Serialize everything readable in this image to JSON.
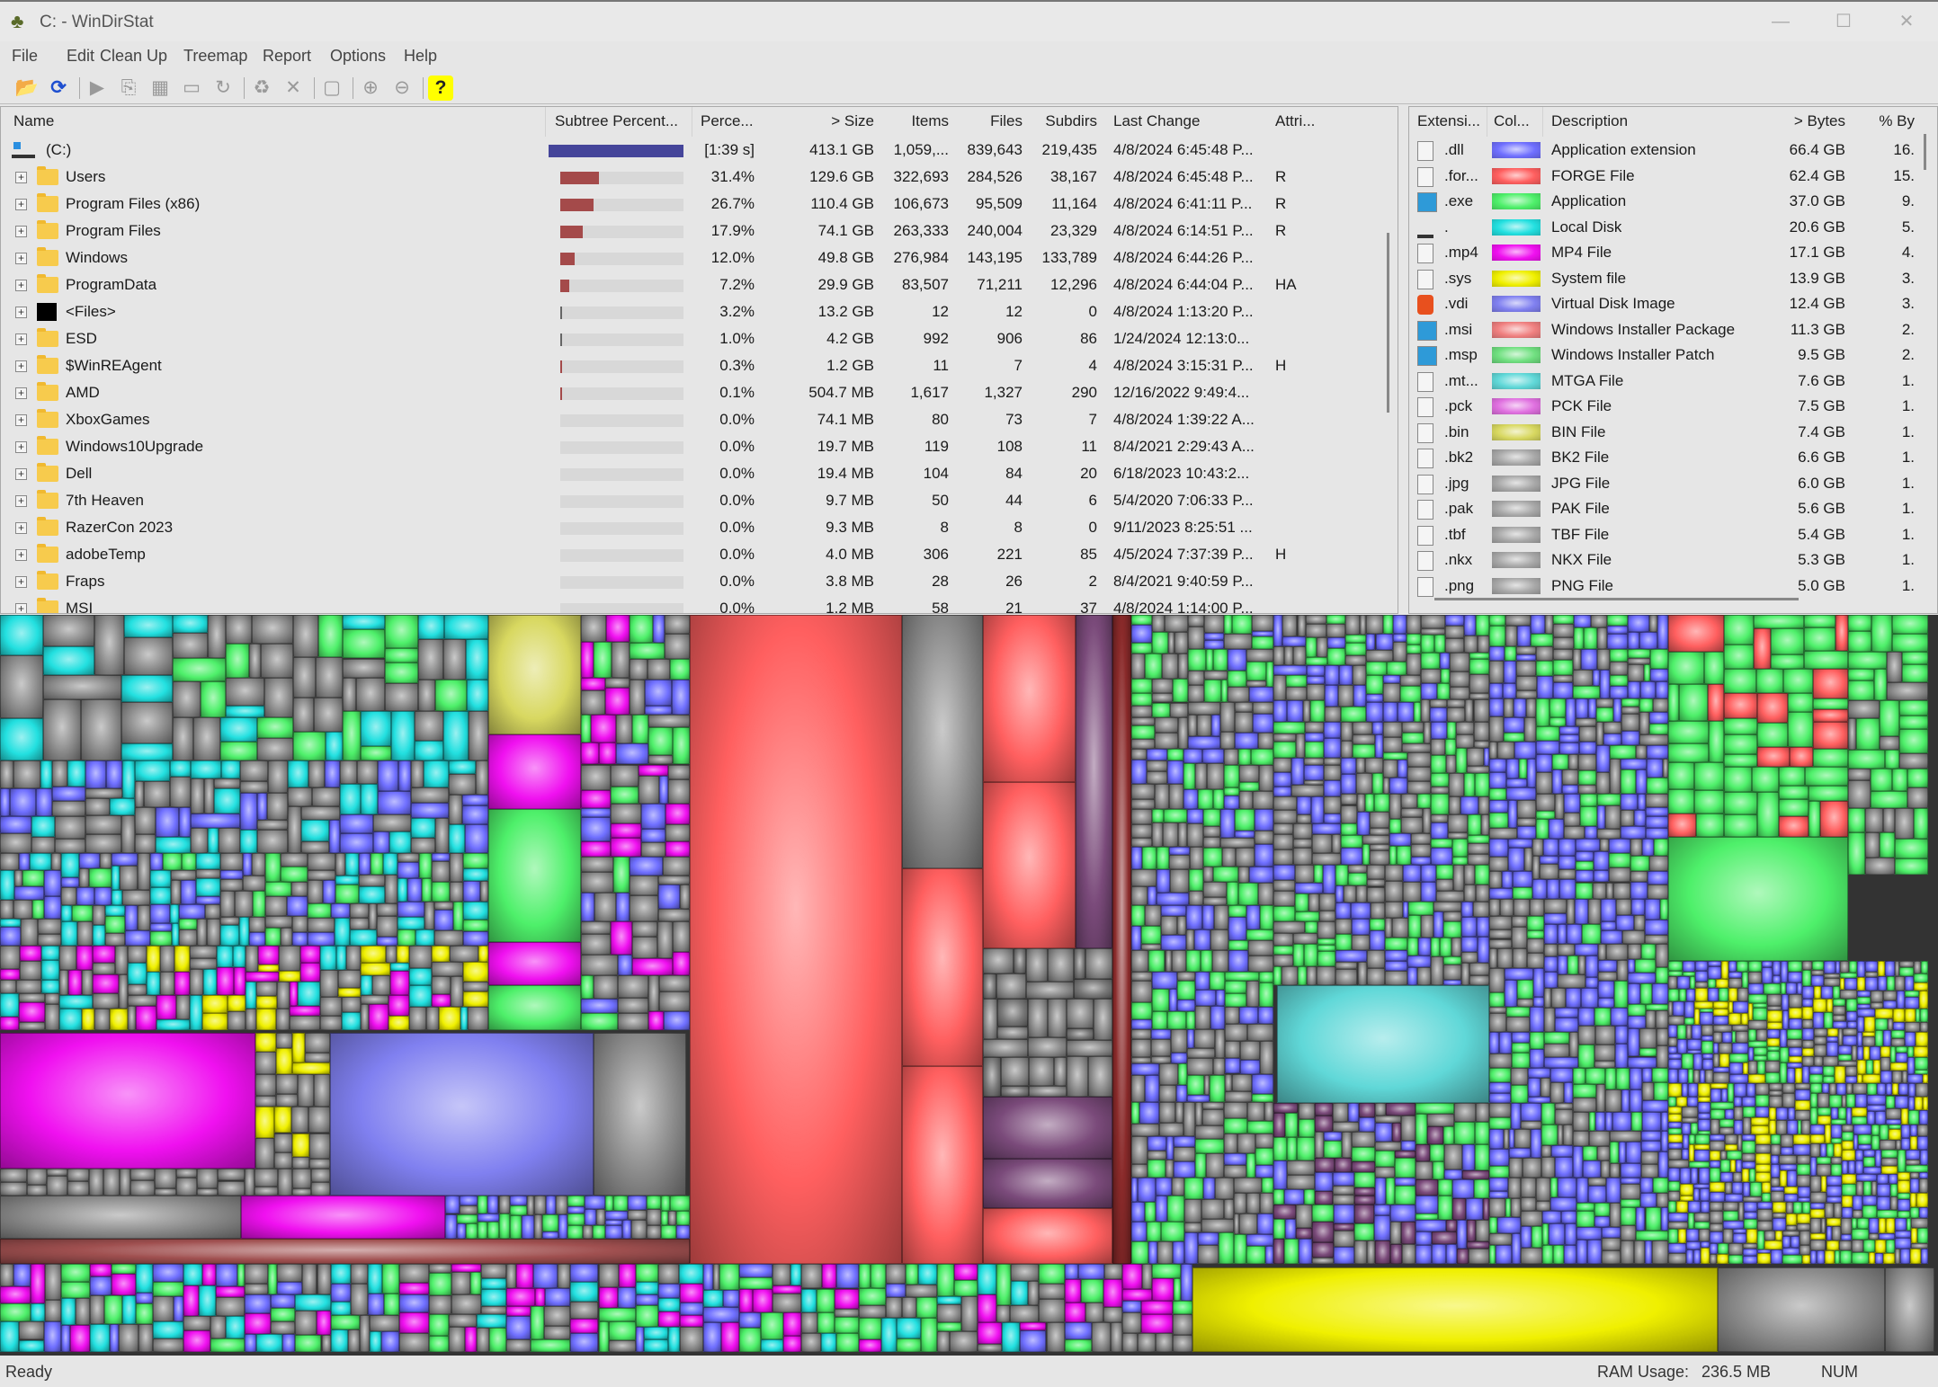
{
  "window": {
    "title": "C: - WinDirStat",
    "icon": "windirstat-tree-icon"
  },
  "menu": [
    "File",
    "Edit",
    "Clean Up",
    "Treemap",
    "Report",
    "Options",
    "Help"
  ],
  "toolbar": [
    "open-icon",
    "refresh-icon",
    "separator",
    "play-icon",
    "copy-path-icon",
    "explorer-icon",
    "command-prompt-icon",
    "refresh-selected-icon",
    "separator",
    "recycle-icon",
    "delete-icon",
    "separator",
    "new-folder-icon",
    "separator",
    "zoom-in-icon",
    "zoom-out-icon",
    "separator",
    "help-icon"
  ],
  "tree": {
    "columns": {
      "name": "Name",
      "subtree": "Subtree Percent...",
      "percent": "Perce...",
      "size": "> Size",
      "items": "Items",
      "files": "Files",
      "subdirs": "Subdirs",
      "last_change": "Last Change",
      "attributes": "Attri..."
    },
    "root": {
      "name": "(C:)",
      "percent": "[1:39 s]",
      "size": "413.1 GB",
      "items": "1,059,...",
      "files": "839,643",
      "subdirs": "219,435",
      "last_change": "4/8/2024 6:45:48 P...",
      "attributes": "",
      "subtree_fraction": 1.0
    },
    "rows": [
      {
        "name": "Users",
        "percent": "31.4%",
        "size": "129.6 GB",
        "items": "322,693",
        "files": "284,526",
        "subdirs": "38,167",
        "last_change": "4/8/2024 6:45:48 P...",
        "attributes": "R",
        "subtree_fraction": 0.314,
        "icon": "folder"
      },
      {
        "name": "Program Files (x86)",
        "percent": "26.7%",
        "size": "110.4 GB",
        "items": "106,673",
        "files": "95,509",
        "subdirs": "11,164",
        "last_change": "4/8/2024 6:41:11 P...",
        "attributes": "R",
        "subtree_fraction": 0.267,
        "icon": "folder"
      },
      {
        "name": "Program Files",
        "percent": "17.9%",
        "size": "74.1 GB",
        "items": "263,333",
        "files": "240,004",
        "subdirs": "23,329",
        "last_change": "4/8/2024 6:14:51 P...",
        "attributes": "R",
        "subtree_fraction": 0.179,
        "icon": "folder"
      },
      {
        "name": "Windows",
        "percent": "12.0%",
        "size": "49.8 GB",
        "items": "276,984",
        "files": "143,195",
        "subdirs": "133,789",
        "last_change": "4/8/2024 6:44:26 P...",
        "attributes": "",
        "subtree_fraction": 0.12,
        "icon": "folder"
      },
      {
        "name": "ProgramData",
        "percent": "7.2%",
        "size": "29.9 GB",
        "items": "83,507",
        "files": "71,211",
        "subdirs": "12,296",
        "last_change": "4/8/2024 6:44:04 P...",
        "attributes": "HA",
        "subtree_fraction": 0.072,
        "icon": "folder"
      },
      {
        "name": "<Files>",
        "percent": "3.2%",
        "size": "13.2 GB",
        "items": "12",
        "files": "12",
        "subdirs": "0",
        "last_change": "4/8/2024 1:13:20 P...",
        "attributes": "",
        "subtree_fraction": 0.032,
        "icon": "files"
      },
      {
        "name": "ESD",
        "percent": "1.0%",
        "size": "4.2 GB",
        "items": "992",
        "files": "906",
        "subdirs": "86",
        "last_change": "1/24/2024 12:13:0...",
        "attributes": "",
        "subtree_fraction": 0.01,
        "icon": "folder"
      },
      {
        "name": "$WinREAgent",
        "percent": "0.3%",
        "size": "1.2 GB",
        "items": "11",
        "files": "7",
        "subdirs": "4",
        "last_change": "4/8/2024 3:15:31 P...",
        "attributes": "H",
        "subtree_fraction": 0.003,
        "icon": "folder"
      },
      {
        "name": "AMD",
        "percent": "0.1%",
        "size": "504.7 MB",
        "items": "1,617",
        "files": "1,327",
        "subdirs": "290",
        "last_change": "12/16/2022 9:49:4...",
        "attributes": "",
        "subtree_fraction": 0.001,
        "icon": "folder"
      },
      {
        "name": "XboxGames",
        "percent": "0.0%",
        "size": "74.1 MB",
        "items": "80",
        "files": "73",
        "subdirs": "7",
        "last_change": "4/8/2024 1:39:22 A...",
        "attributes": "",
        "subtree_fraction": 0,
        "icon": "folder"
      },
      {
        "name": "Windows10Upgrade",
        "percent": "0.0%",
        "size": "19.7 MB",
        "items": "119",
        "files": "108",
        "subdirs": "11",
        "last_change": "8/4/2021 2:29:43 A...",
        "attributes": "",
        "subtree_fraction": 0,
        "icon": "folder"
      },
      {
        "name": "Dell",
        "percent": "0.0%",
        "size": "19.4 MB",
        "items": "104",
        "files": "84",
        "subdirs": "20",
        "last_change": "6/18/2023 10:43:2...",
        "attributes": "",
        "subtree_fraction": 0,
        "icon": "folder"
      },
      {
        "name": "7th Heaven",
        "percent": "0.0%",
        "size": "9.7 MB",
        "items": "50",
        "files": "44",
        "subdirs": "6",
        "last_change": "5/4/2020 7:06:33 P...",
        "attributes": "",
        "subtree_fraction": 0,
        "icon": "folder"
      },
      {
        "name": "RazerCon 2023",
        "percent": "0.0%",
        "size": "9.3 MB",
        "items": "8",
        "files": "8",
        "subdirs": "0",
        "last_change": "9/11/2023 8:25:51 ...",
        "attributes": "",
        "subtree_fraction": 0,
        "icon": "folder"
      },
      {
        "name": "adobeTemp",
        "percent": "0.0%",
        "size": "4.0 MB",
        "items": "306",
        "files": "221",
        "subdirs": "85",
        "last_change": "4/5/2024 7:37:39 P...",
        "attributes": "H",
        "subtree_fraction": 0,
        "icon": "folder"
      },
      {
        "name": "Fraps",
        "percent": "0.0%",
        "size": "3.8 MB",
        "items": "28",
        "files": "26",
        "subdirs": "2",
        "last_change": "8/4/2021 9:40:59 P...",
        "attributes": "",
        "subtree_fraction": 0,
        "icon": "folder"
      },
      {
        "name": "MSI",
        "percent": "0.0%",
        "size": "1.2 MB",
        "items": "58",
        "files": "21",
        "subdirs": "37",
        "last_change": "4/8/2024 1:14:00 P...",
        "attributes": "",
        "subtree_fraction": 0,
        "icon": "folder"
      }
    ]
  },
  "extensions": {
    "columns": {
      "ext": "Extensi...",
      "color": "Col...",
      "desc": "Description",
      "bytes": "> Bytes",
      "pct": "% By"
    },
    "rows": [
      {
        "ext": ".dll",
        "color": "#6f6fff",
        "desc": "Application extension",
        "bytes": "66.4 GB",
        "pct": "16."
      },
      {
        "ext": ".for...",
        "color": "#ff5f5f",
        "desc": "FORGE File",
        "bytes": "62.4 GB",
        "pct": "15."
      },
      {
        "ext": ".exe",
        "color": "#4ef06a",
        "desc": "Application",
        "bytes": "37.0 GB",
        "pct": "9."
      },
      {
        "ext": ".",
        "color": "#22e0e0",
        "desc": "Local Disk",
        "bytes": "20.6 GB",
        "pct": "5."
      },
      {
        "ext": ".mp4",
        "color": "#f010f0",
        "desc": "MP4 File",
        "bytes": "17.1 GB",
        "pct": "4."
      },
      {
        "ext": ".sys",
        "color": "#f0f000",
        "desc": "System file",
        "bytes": "13.9 GB",
        "pct": "3."
      },
      {
        "ext": ".vdi",
        "color": "#8080f0",
        "desc": "Virtual Disk Image",
        "bytes": "12.4 GB",
        "pct": "3."
      },
      {
        "ext": ".msi",
        "color": "#f08080",
        "desc": "Windows Installer Package",
        "bytes": "11.3 GB",
        "pct": "2."
      },
      {
        "ext": ".msp",
        "color": "#70e080",
        "desc": "Windows Installer Patch",
        "bytes": "9.5 GB",
        "pct": "2."
      },
      {
        "ext": ".mt...",
        "color": "#60d8d8",
        "desc": "MTGA File",
        "bytes": "7.6 GB",
        "pct": "1."
      },
      {
        "ext": ".pck",
        "color": "#e070e0",
        "desc": "PCK File",
        "bytes": "7.5 GB",
        "pct": "1."
      },
      {
        "ext": ".bin",
        "color": "#d8d860",
        "desc": "BIN File",
        "bytes": "7.4 GB",
        "pct": "1."
      },
      {
        "ext": ".bk2",
        "color": "#a8a8a8",
        "desc": "BK2 File",
        "bytes": "6.6 GB",
        "pct": "1."
      },
      {
        "ext": ".jpg",
        "color": "#a8a8a8",
        "desc": "JPG File",
        "bytes": "6.0 GB",
        "pct": "1."
      },
      {
        "ext": ".pak",
        "color": "#a8a8a8",
        "desc": "PAK File",
        "bytes": "5.6 GB",
        "pct": "1."
      },
      {
        "ext": ".tbf",
        "color": "#a8a8a8",
        "desc": "TBF File",
        "bytes": "5.4 GB",
        "pct": "1."
      },
      {
        "ext": ".nkx",
        "color": "#a8a8a8",
        "desc": "NKX File",
        "bytes": "5.3 GB",
        "pct": "1."
      },
      {
        "ext": ".png",
        "color": "#a8a8a8",
        "desc": "PNG File",
        "bytes": "5.0 GB",
        "pct": "1."
      }
    ]
  },
  "colors": {
    "root_bar": "#45459a",
    "subtree_bar": "#a44a4a",
    "grey": "#8a8a8a"
  },
  "status": {
    "text": "Ready",
    "ram_label": "RAM Usage:",
    "ram_value": "236.5 MB",
    "num": "NUM"
  }
}
